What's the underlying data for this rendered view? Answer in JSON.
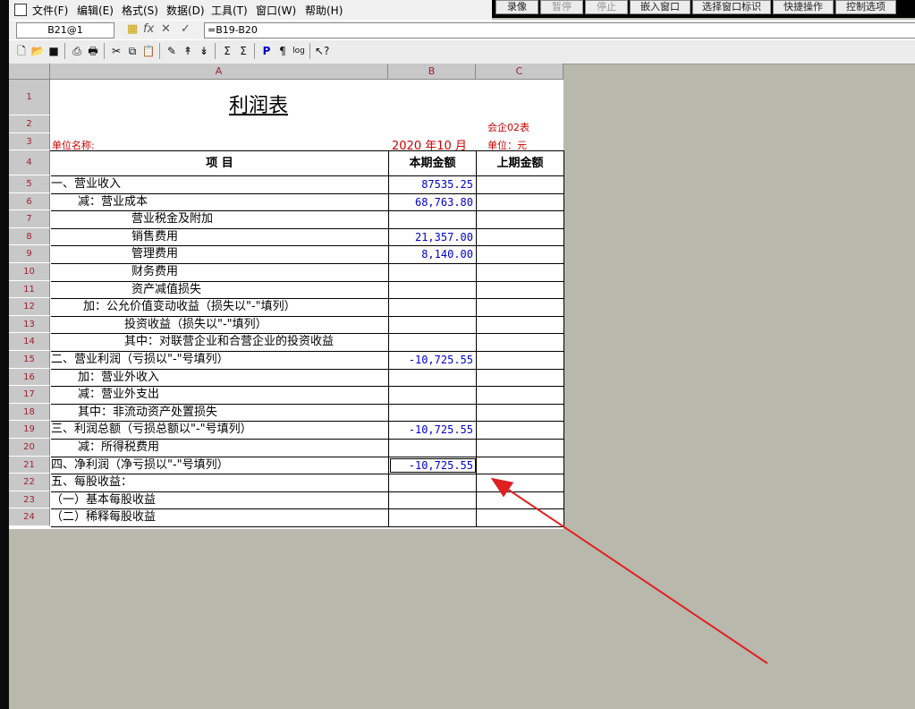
{
  "menu": [
    "文件(F)",
    "编辑(E)",
    "格式(S)",
    "数据(D)",
    "工具(T)",
    "窗口(W)",
    "帮助(H)"
  ],
  "top_buttons": [
    {
      "label": "录像",
      "disabled": false
    },
    {
      "label": "暂停",
      "disabled": true
    },
    {
      "label": "停止",
      "disabled": true
    },
    {
      "label": "嵌入窗口",
      "disabled": false
    },
    {
      "label": "选择窗口标识",
      "disabled": false
    },
    {
      "label": "快捷操作",
      "disabled": false
    },
    {
      "label": "控制选项",
      "disabled": false
    }
  ],
  "formula_bar": {
    "cell_ref": "B21@1",
    "formula": "=B19-B20"
  },
  "toolbar_icons": [
    "new-icon",
    "open-icon",
    "save-icon",
    "print-preview-icon",
    "print-icon",
    "cut-icon",
    "copy-icon",
    "paste-icon",
    "format-painter-icon",
    "sort-asc-icon",
    "sort-desc-icon",
    "sum-icon",
    "sum-all-icon",
    "p-icon",
    "page-icon",
    "log-icon",
    "help-pointer-icon"
  ],
  "columns": [
    "A",
    "B",
    "C"
  ],
  "sheet": {
    "title": "利润表",
    "form_code": "会企02表",
    "unit_name_label": "单位名称:",
    "period": "2020 年10 月",
    "unit": "单位：元",
    "header": {
      "item": "项          目",
      "current": "本期金额",
      "previous": "上期金额"
    }
  },
  "rows": [
    {
      "n": "5",
      "item": "一、营业收入",
      "indent": 0,
      "current": "87535.25"
    },
    {
      "n": "6",
      "item": "减：营业成本",
      "indent": 30,
      "current": "68,763.80"
    },
    {
      "n": "7",
      "item": "营业税金及附加",
      "indent": 90,
      "current": ""
    },
    {
      "n": "8",
      "item": "销售费用",
      "indent": 90,
      "current": "21,357.00"
    },
    {
      "n": "9",
      "item": "管理费用",
      "indent": 90,
      "current": "8,140.00"
    },
    {
      "n": "10",
      "item": "财务费用",
      "indent": 90,
      "current": ""
    },
    {
      "n": "11",
      "item": "资产减值损失",
      "indent": 90,
      "current": ""
    },
    {
      "n": "12",
      "item": "加：公允价值变动收益（损失以\"-\"填列）",
      "indent": 36,
      "current": ""
    },
    {
      "n": "13",
      "item": "投资收益（损失以\"-\"填列）",
      "indent": 82,
      "current": ""
    },
    {
      "n": "14",
      "item": "其中：对联营企业和合营企业的投资收益",
      "indent": 82,
      "current": ""
    },
    {
      "n": "15",
      "item": "二、营业利润（亏损以\"-\"号填列）",
      "indent": 0,
      "current": "-10,725.55"
    },
    {
      "n": "16",
      "item": "加：营业外收入",
      "indent": 30,
      "current": ""
    },
    {
      "n": "17",
      "item": "减：营业外支出",
      "indent": 30,
      "current": ""
    },
    {
      "n": "18",
      "item": "其中：非流动资产处置损失",
      "indent": 30,
      "current": ""
    },
    {
      "n": "19",
      "item": "三、利润总额（亏损总额以\"-\"号填列）",
      "indent": 0,
      "current": "-10,725.55"
    },
    {
      "n": "20",
      "item": "减：所得税费用",
      "indent": 30,
      "current": ""
    },
    {
      "n": "21",
      "item": "四、净利润（净亏损以\"-\"号填列）",
      "indent": 0,
      "current": "-10,725.55",
      "selected": true
    },
    {
      "n": "22",
      "item": "五、每股收益：",
      "indent": 0,
      "current": ""
    },
    {
      "n": "23",
      "item": "（一）基本每股收益",
      "indent": 0,
      "current": ""
    },
    {
      "n": "24",
      "item": "（二）稀释每股收益",
      "indent": 0,
      "current": ""
    }
  ],
  "header_row_numbers": [
    "1",
    "2",
    "3",
    "4"
  ],
  "colors": {
    "accent_red": "#cc0000",
    "number_blue": "#0000cc",
    "arrow": "#e02020"
  }
}
